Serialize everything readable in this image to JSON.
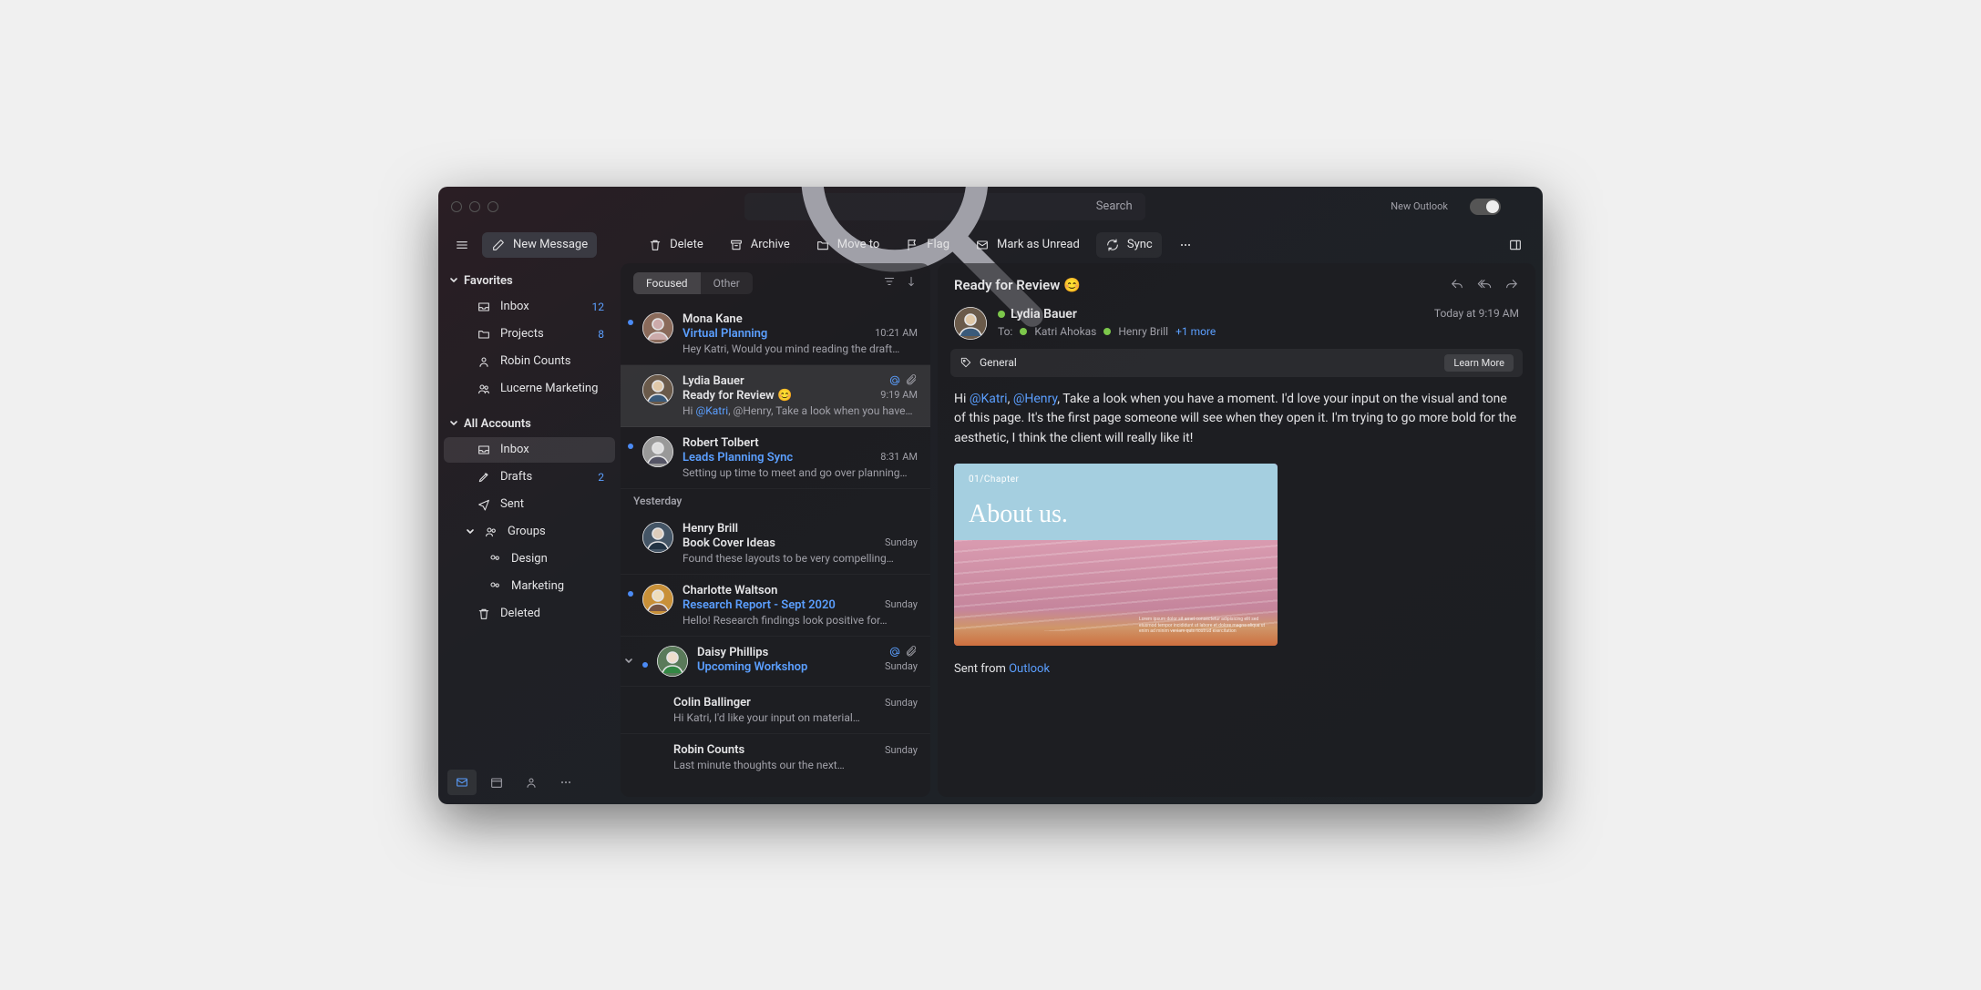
{
  "titlebar": {
    "search_placeholder": "Search",
    "new_outlook_label": "New Outlook"
  },
  "toolbar": {
    "new_message": "New Message",
    "delete": "Delete",
    "archive": "Archive",
    "move_to": "Move to",
    "flag": "Flag",
    "mark_unread": "Mark as Unread",
    "sync": "Sync"
  },
  "sidebar": {
    "favorites_label": "Favorites",
    "all_accounts_label": "All Accounts",
    "favorites": [
      {
        "label": "Inbox",
        "count": "12",
        "icon": "inbox"
      },
      {
        "label": "Projects",
        "count": "8",
        "icon": "folder"
      },
      {
        "label": "Robin Counts",
        "icon": "person"
      },
      {
        "label": "Lucerne Marketing",
        "icon": "group"
      }
    ],
    "accounts": [
      {
        "label": "Inbox",
        "icon": "inbox",
        "selected": true
      },
      {
        "label": "Drafts",
        "count": "2",
        "icon": "drafts"
      },
      {
        "label": "Sent",
        "icon": "sent"
      },
      {
        "label": "Groups",
        "icon": "group",
        "expandable": true,
        "children": [
          {
            "label": "Design"
          },
          {
            "label": "Marketing"
          }
        ]
      },
      {
        "label": "Deleted",
        "icon": "trash"
      }
    ]
  },
  "list": {
    "tabs": {
      "focused": "Focused",
      "other": "Other"
    },
    "yesterday_label": "Yesterday",
    "messages": [
      {
        "from": "Mona Kane",
        "subject": "Virtual Planning",
        "preview": "Hey Katri, Would you mind reading the draft…",
        "time": "10:21 AM",
        "unread": true,
        "blue": true,
        "avatar": "mk"
      },
      {
        "from": "Lydia Bauer",
        "subject": "Ready for Review 😊",
        "preview_pre": "Hi ",
        "preview_mention": "@Katri",
        "preview_post": ", @Henry, Take a look when you have…",
        "time": "9:19 AM",
        "selected": true,
        "mention": true,
        "attach": true,
        "avatar": "lb"
      },
      {
        "from": "Robert Tolbert",
        "subject": "Leads Planning Sync",
        "preview": "Setting up time to meet and go over planning…",
        "time": "8:31 AM",
        "unread": true,
        "blue": true,
        "avatar": "rt"
      }
    ],
    "yesterday": [
      {
        "from": "Henry Brill",
        "subject": "Book Cover Ideas",
        "preview": "Found these layouts to be very compelling…",
        "time": "Sunday",
        "avatar": "hb"
      },
      {
        "from": "Charlotte Waltson",
        "subject": "Research Report - Sept 2020",
        "preview": "Hello! Research findings look positive for…",
        "time": "Sunday",
        "unread": true,
        "blue": true,
        "avatar": "cw"
      },
      {
        "from": "Daisy Phillips",
        "subject": "Upcoming Workshop",
        "time": "Sunday",
        "unread": true,
        "blue": true,
        "mention": true,
        "attach": true,
        "expandable": true,
        "avatar": "dp"
      },
      {
        "from": "Colin Ballinger",
        "preview": "Hi Katri, I'd like your input on material…",
        "time": "Sunday"
      },
      {
        "from": "Robin Counts",
        "preview": "Last minute thoughts our the next…",
        "time": "Sunday"
      }
    ]
  },
  "pane": {
    "subject": "Ready for Review 😊",
    "sender": "Lydia Bauer",
    "to_label": "To:",
    "to": [
      {
        "name": "Katri Ahokas"
      },
      {
        "name": "Henry Brill"
      }
    ],
    "more": "+1 more",
    "time": "Today at 9:19 AM",
    "tag": "General",
    "learn_more": "Learn More",
    "body_pre": "Hi ",
    "mention1": "@Katri",
    "body_mid1": ", ",
    "mention2": "@Henry",
    "body_post": ", Take a look when you have a moment. I'd love your input on the visual and tone of this page. It's the first page someone will see when they open it. I'm trying to go more bold for the aesthetic, I think the client will really like it!",
    "image": {
      "chapter": "01/Chapter",
      "title": "About us."
    },
    "sent_from_pre": "Sent from ",
    "sent_from_link": "Outlook"
  }
}
